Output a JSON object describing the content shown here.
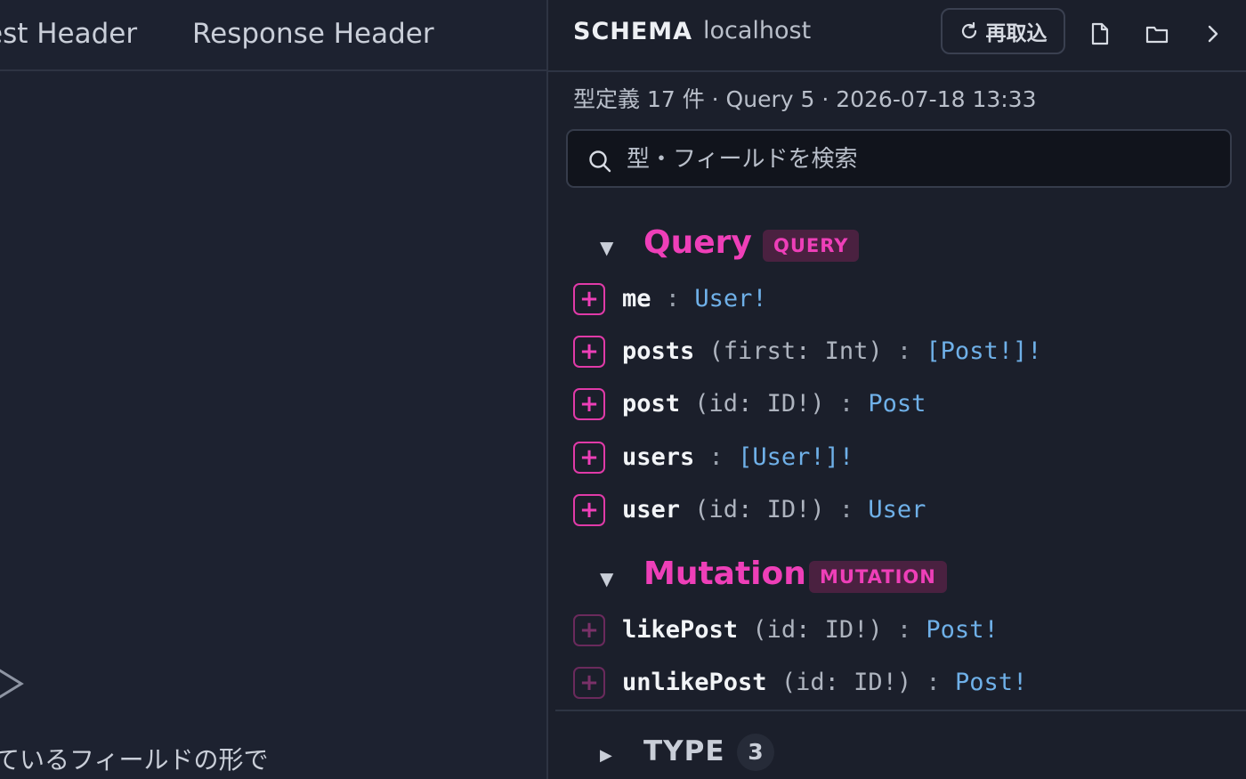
{
  "left_panel": {
    "tabs": [
      "est Header",
      "Response Header"
    ],
    "bottom_text": "ているフィールドの形で"
  },
  "schema": {
    "title": "SCHEMA",
    "host": "localhost",
    "reload_label": "再取込",
    "meta": "型定義 17 件 · Query 5 · 2026-07-18 13:33",
    "search_placeholder": "型・フィールドを検索",
    "query_group": {
      "name": "Query",
      "badge": "QUERY",
      "fields": [
        {
          "name": "me",
          "args": "",
          "type": "User!"
        },
        {
          "name": "posts",
          "args": "(first: Int)",
          "type": "[Post!]!"
        },
        {
          "name": "post",
          "args": "(id: ID!)",
          "type": "Post"
        },
        {
          "name": "users",
          "args": "",
          "type": "[User!]!"
        },
        {
          "name": "user",
          "args": "(id: ID!)",
          "type": "User"
        }
      ]
    },
    "mutation_group": {
      "name": "Mutation",
      "badge": "MUTATION",
      "fields": [
        {
          "name": "likePost",
          "args": "(id: ID!)",
          "type": "Post!"
        },
        {
          "name": "unlikePost",
          "args": "(id: ID!)",
          "type": "Post!"
        }
      ]
    },
    "type_section": {
      "label": "TYPE",
      "count": "3"
    }
  },
  "colors": {
    "accent": "#ee3fb8",
    "type_color": "#6fb0e8",
    "background": "#1b1f2b"
  }
}
